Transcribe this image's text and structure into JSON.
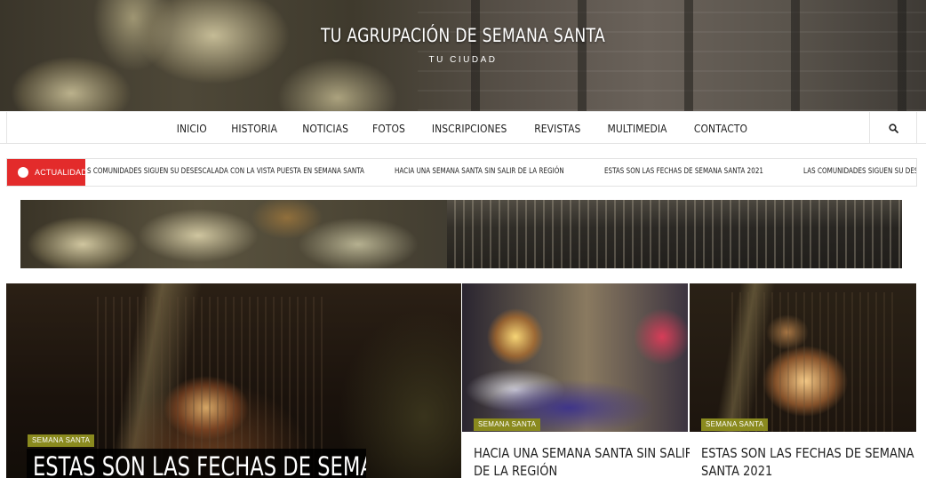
{
  "site": {
    "title": "TU AGRUPACIÓN DE SEMANA SANTA",
    "tagline": "TU CIUDAD"
  },
  "nav": {
    "items": [
      "INICIO",
      "HISTORIA",
      "NOTICIAS",
      "FOTOS",
      "INSCRIPCIONES",
      "REVISTAS",
      "MULTIMEDIA",
      "CONTACTO"
    ],
    "search_icon": "search-icon"
  },
  "ticker": {
    "label": "ACTUALIDAD",
    "items": [
      "S COMUNIDADES SIGUEN SU DESESCALADA CON LA VISTA PUESTA EN SEMANA SANTA",
      "HACIA UNA SEMANA SANTA SIN SALIR DE LA REGIÓN",
      "ESTAS SON LAS FECHAS DE SEMANA SANTA 2021",
      "LAS COMUNIDADES SIGUEN SU DESE"
    ],
    "accent": "#e32b2b"
  },
  "featured": {
    "main": {
      "category": "SEMANA SANTA",
      "title": "ESTAS SON LAS FECHAS DE SEMANA"
    },
    "side": [
      {
        "category": "SEMANA SANTA",
        "title": "HACIA UNA SEMANA SANTA SIN SALIR DE LA REGIÓN"
      },
      {
        "category": "SEMANA SANTA",
        "title": "ESTAS SON LAS FECHAS DE SEMANA SANTA 2021"
      }
    ],
    "badge_color": "#8a8a1e"
  }
}
